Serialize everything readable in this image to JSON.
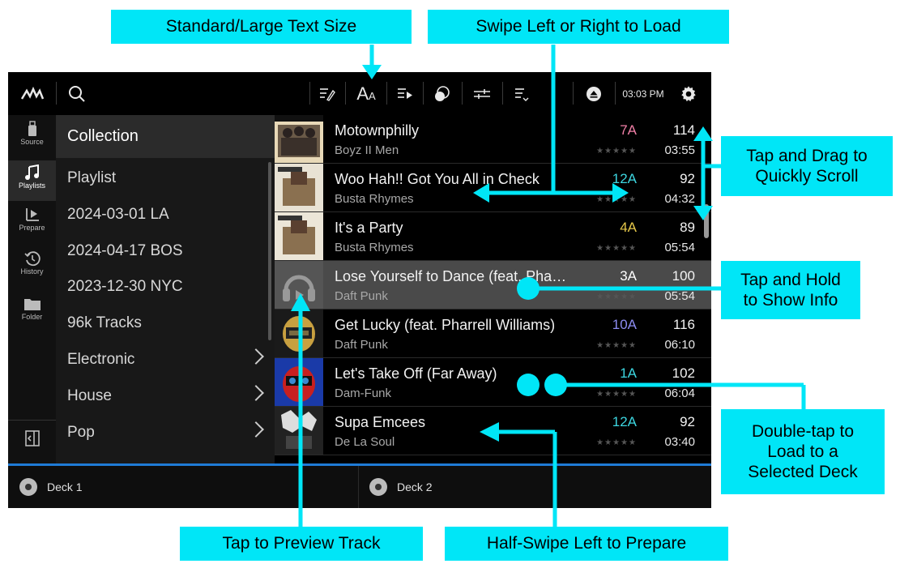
{
  "topbar": {
    "clock": "03:03 PM",
    "icons": [
      "logo-icon",
      "search-icon",
      "edit-list-icon",
      "text-size-icon",
      "playlist-play-icon",
      "circles-icon",
      "sliders-icon",
      "list-filter-icon",
      "eject-icon",
      "gear-icon"
    ]
  },
  "sidebar": {
    "items": [
      {
        "label": "Source",
        "icon": "usb-drive-icon"
      },
      {
        "label": "Playlists",
        "icon": "music-note-icon"
      },
      {
        "label": "Prepare",
        "icon": "prepare-icon"
      },
      {
        "label": "History",
        "icon": "history-icon"
      },
      {
        "label": "Folder",
        "icon": "folder-icon"
      }
    ]
  },
  "playlists": {
    "items": [
      {
        "label": "Collection"
      },
      {
        "label": "Playlist"
      },
      {
        "label": "2024-03-01 LA"
      },
      {
        "label": "2024-04-17 BOS"
      },
      {
        "label": "2023-12-30 NYC"
      },
      {
        "label": "96k Tracks"
      },
      {
        "label": "Electronic"
      },
      {
        "label": "House"
      },
      {
        "label": "Pop"
      }
    ]
  },
  "tracks": [
    {
      "title": "Motownphilly",
      "artist": "Boyz II Men",
      "key": "7A",
      "key_color": "#f07fa6",
      "bpm": "114",
      "duration": "03:55"
    },
    {
      "title": "Woo Hah!! Got You All in Check",
      "artist": "Busta Rhymes",
      "key": "12A",
      "key_color": "#3dd6e0",
      "bpm": "92",
      "duration": "04:32"
    },
    {
      "title": "It's a Party",
      "artist": "Busta Rhymes",
      "key": "4A",
      "key_color": "#e6c84a",
      "bpm": "89",
      "duration": "05:54"
    },
    {
      "title": "Lose Yourself to Dance (feat. Pha…",
      "artist": "Daft Punk",
      "key": "3A",
      "key_color": "#ffffff",
      "bpm": "100",
      "duration": "05:54"
    },
    {
      "title": "Get Lucky (feat. Pharrell Williams)",
      "artist": "Daft Punk",
      "key": "10A",
      "key_color": "#8c8cf0",
      "bpm": "116",
      "duration": "06:10"
    },
    {
      "title": "Let's Take Off (Far Away)",
      "artist": "Dam-Funk",
      "key": "1A",
      "key_color": "#3dd6e0",
      "bpm": "102",
      "duration": "06:04"
    },
    {
      "title": "Supa Emcees",
      "artist": "De La Soul",
      "key": "12A",
      "key_color": "#3dd6e0",
      "bpm": "92",
      "duration": "03:40"
    }
  ],
  "stars": "★★★★★",
  "decks": [
    {
      "label": "Deck 1"
    },
    {
      "label": "Deck 2"
    }
  ],
  "callouts": {
    "text_size": "Standard/Large Text Size",
    "swipe_load": "Swipe Left or Right to Load",
    "tap_drag": "Tap and Drag to Quickly Scroll",
    "tap_hold": "Tap and Hold to Show Info",
    "double_tap": "Double-tap to Load to a Selected Deck",
    "preview": "Tap to Preview Track",
    "half_swipe": "Half-Swipe Left to Prepare"
  },
  "colors": {
    "accent": "#00e6f7",
    "deck_bar": "#1f7bd6"
  }
}
